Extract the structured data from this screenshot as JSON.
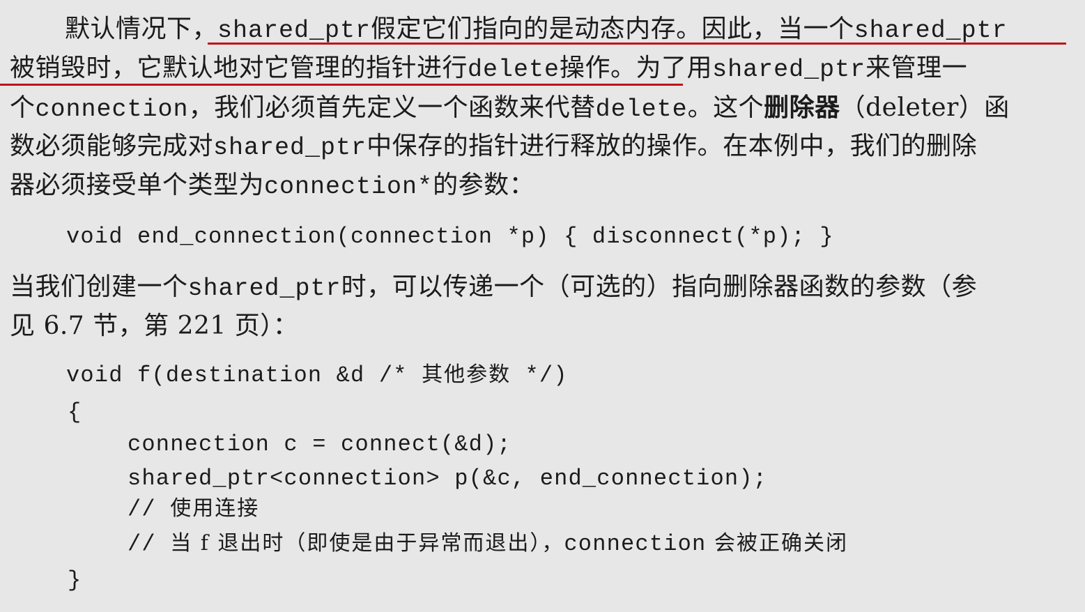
{
  "para1": {
    "l1_a": "默认情况下，",
    "l1_b": "shared_ptr",
    "l1_c": "假定它们指向的是动态内存。因此，当一个",
    "l1_d": "shared_ptr",
    "l2_a": "被销毁时，它默认地对它管理的指针进行",
    "l2_b": "delete",
    "l2_c": "操作。为了用",
    "l2_d": "shared_ptr",
    "l2_e": "来管理一",
    "l3_a": "个",
    "l3_b": "connection",
    "l3_c": "，我们必须首先定义一个函数来代替",
    "l3_d": "delete",
    "l3_e": "。这个",
    "l3_f": "删除器",
    "l3_g": "（deleter）函",
    "l4_a": "数必须能够完成对",
    "l4_b": "shared_ptr",
    "l4_c": "中保存的指针进行释放的操作。在本例中，我们的删除",
    "l5_a": "器必须接受单个类型为",
    "l5_b": "connection*",
    "l5_c": "的参数："
  },
  "code1": "void end_connection(connection *p) { disconnect(*p); }",
  "para2": {
    "l1_a": "当我们创建一个",
    "l1_b": "shared_ptr",
    "l1_c": "时，可以传递一个（可选的）指向删除器函数的参数（参",
    "l2": "见 6.7 节，第 221 页）："
  },
  "code2": {
    "l1_a": "void f(destination &d /* ",
    "l1_b": "其他参数",
    "l1_c": " */)",
    "l2": "{",
    "l3": "connection c = connect(&d);",
    "l4": "shared_ptr<connection> p(&c, end_connection);",
    "l5_a": "// ",
    "l5_b": "使用连接",
    "l6_a": "// ",
    "l6_b": "当 f 退出时（即使是由于异常而退出），",
    "l6_c": "connection",
    "l6_d": " 会被正确关闭",
    "l7": "}"
  },
  "colors": {
    "background": "#e7e7e7",
    "text": "#1b1b1b",
    "highlight_underline": "#c0121c"
  }
}
